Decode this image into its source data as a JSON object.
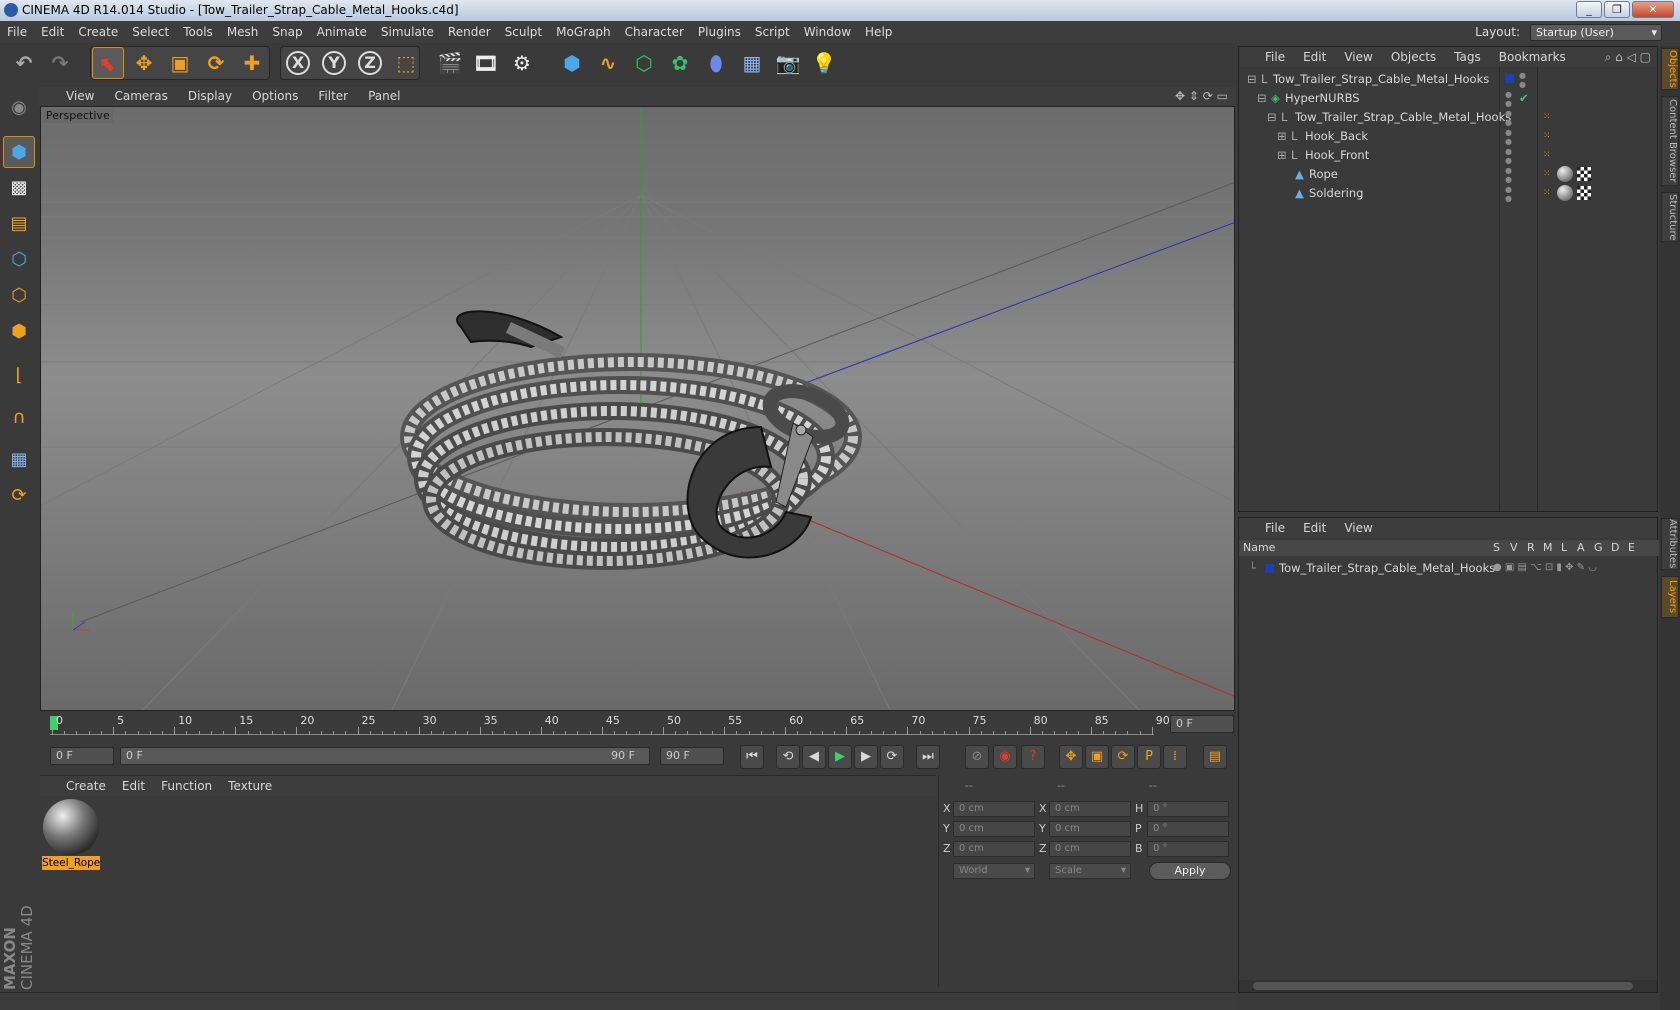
{
  "titlebar": {
    "title": "CINEMA 4D R14.014 Studio - [Tow_Trailer_Strap_Cable_Metal_Hooks.c4d]"
  },
  "menubar": {
    "items": [
      "File",
      "Edit",
      "Create",
      "Select",
      "Tools",
      "Mesh",
      "Snap",
      "Animate",
      "Simulate",
      "Render",
      "Sculpt",
      "MoGraph",
      "Character",
      "Plugins",
      "Script",
      "Window",
      "Help"
    ],
    "layout_label": "Layout:",
    "layout_value": "Startup (User)"
  },
  "toolbar": {
    "axis_x": "X",
    "axis_y": "Y",
    "axis_z": "Z"
  },
  "viewport": {
    "menu": [
      "View",
      "Cameras",
      "Display",
      "Options",
      "Filter",
      "Panel"
    ],
    "label": "Perspective"
  },
  "timeline": {
    "ticks": [
      "0",
      "5",
      "10",
      "15",
      "20",
      "25",
      "30",
      "35",
      "40",
      "45",
      "50",
      "55",
      "60",
      "65",
      "70",
      "75",
      "80",
      "85",
      "90"
    ],
    "current_frame": "0 F"
  },
  "transport": {
    "start_field": "0 F",
    "range_start": "0 F",
    "range_end": "90 F",
    "end_field": "90 F"
  },
  "material_panel": {
    "menu": [
      "Create",
      "Edit",
      "Function",
      "Texture"
    ],
    "materials": [
      {
        "name": "Steel_Rope"
      }
    ]
  },
  "coord_panel": {
    "headers": [
      "--",
      "--",
      "--"
    ],
    "rows": [
      {
        "a": "X",
        "av": "0 cm",
        "b": "X",
        "bv": "0 cm",
        "c": "H",
        "cv": "0 °"
      },
      {
        "a": "Y",
        "av": "0 cm",
        "b": "Y",
        "bv": "0 cm",
        "c": "P",
        "cv": "0 °"
      },
      {
        "a": "Z",
        "av": "0 cm",
        "b": "Z",
        "bv": "0 cm",
        "c": "B",
        "cv": "0 °"
      }
    ],
    "mode": "World",
    "scale": "Scale",
    "apply": "Apply"
  },
  "object_panel": {
    "menu": [
      "File",
      "Edit",
      "View",
      "Objects",
      "Tags",
      "Bookmarks"
    ],
    "objects": [
      {
        "name": "Tow_Trailer_Strap_Cable_Metal_Hooks",
        "depth": 0
      },
      {
        "name": "HyperNURBS",
        "depth": 1
      },
      {
        "name": "Tow_Trailer_Strap_Cable_Metal_Hooks",
        "depth": 2
      },
      {
        "name": "Hook_Back",
        "depth": 3
      },
      {
        "name": "Hook_Front",
        "depth": 3
      },
      {
        "name": "Rope",
        "depth": 3
      },
      {
        "name": "Soldering",
        "depth": 3
      }
    ]
  },
  "layer_panel": {
    "menu": [
      "File",
      "Edit",
      "View"
    ],
    "columns": [
      "Name",
      "S",
      "V",
      "R",
      "M",
      "L",
      "A",
      "G",
      "D",
      "E"
    ],
    "layers": [
      {
        "name": "Tow_Trailer_Strap_Cable_Metal_Hooks",
        "color": "#1f3fb0"
      }
    ]
  },
  "side_tabs": [
    "Objects",
    "Content Browser",
    "Structure",
    "Attributes",
    "Layers"
  ],
  "branding": {
    "line1": "MAXON",
    "line2": "CINEMA 4D"
  },
  "colors": {
    "accent": "#f0a020",
    "selection": "#e88b00",
    "layer_blue": "#1f3fb0"
  }
}
